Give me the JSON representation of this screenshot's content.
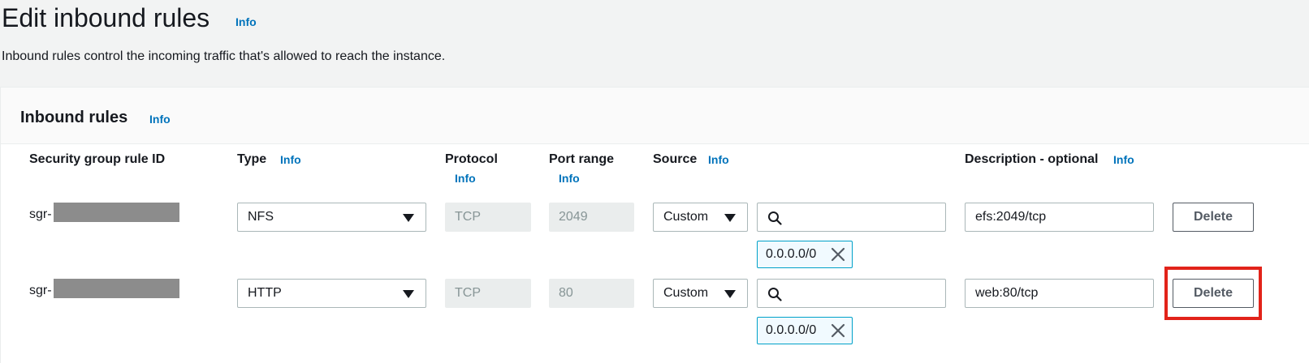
{
  "page": {
    "title": "Edit inbound rules",
    "title_info": "Info",
    "description": "Inbound rules control the incoming traffic that's allowed to reach the instance."
  },
  "panel": {
    "title": "Inbound rules",
    "info": "Info"
  },
  "columns": {
    "rule_id": "Security group rule ID",
    "type": "Type",
    "type_info": "Info",
    "protocol": "Protocol",
    "protocol_info": "Info",
    "port_range": "Port range",
    "port_info": "Info",
    "source": "Source",
    "source_info": "Info",
    "description": "Description - optional",
    "description_info": "Info"
  },
  "rules": [
    {
      "id_prefix": "sgr-",
      "type": "NFS",
      "protocol": "TCP",
      "port_range": "2049",
      "source_mode": "Custom",
      "cidr": "0.0.0.0/0",
      "description": "efs:2049/tcp",
      "delete_label": "Delete"
    },
    {
      "id_prefix": "sgr-",
      "type": "HTTP",
      "protocol": "TCP",
      "port_range": "80",
      "source_mode": "Custom",
      "cidr": "0.0.0.0/0",
      "description": "web:80/tcp",
      "delete_label": "Delete"
    }
  ],
  "icons": {
    "search": "search-icon",
    "remove": "close-icon",
    "dropdown": "caret-down-icon"
  },
  "colors": {
    "link": "#0073bb",
    "highlight": "#e2231a",
    "token_border": "#00a1c9"
  }
}
